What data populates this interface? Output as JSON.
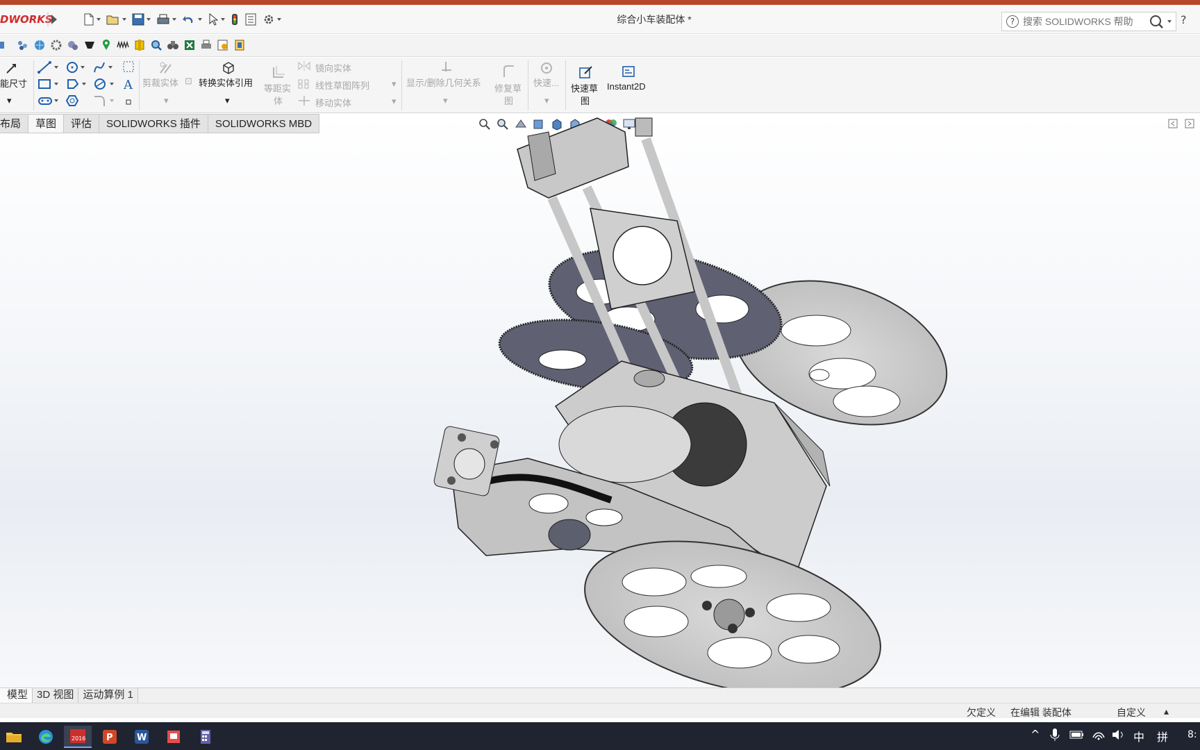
{
  "app": {
    "logo_text": "DWORKS",
    "document_title": "综合小车装配体 *"
  },
  "search": {
    "placeholder": "搜索 SOLIDWORKS 帮助",
    "help_symbol": "?"
  },
  "ribbon": {
    "smart_dimension": "能尺寸",
    "trim_entities": "剪裁实体",
    "convert_entities": "转换实体引用",
    "offset_entities_1": "等距实",
    "offset_entities_2": "体",
    "mirror_entities": "镜向实体",
    "linear_pattern": "线性草图阵列",
    "move_entities": "移动实体",
    "display_relations": "显示/删除几何关系",
    "repair_sketch_1": "修复草",
    "repair_sketch_2": "图",
    "quick_snaps": "快速...",
    "rapid_sketch_1": "快速草",
    "rapid_sketch_2": "图",
    "instant2d": "Instant2D"
  },
  "tabs": [
    {
      "label": "布局",
      "active": false
    },
    {
      "label": "草图",
      "active": true
    },
    {
      "label": "评估",
      "active": false
    },
    {
      "label": "SOLIDWORKS 插件",
      "active": false
    },
    {
      "label": "SOLIDWORKS MBD",
      "active": false
    }
  ],
  "bottom_tabs": [
    {
      "label": "模型",
      "active": true
    },
    {
      "label": "3D 视图",
      "active": false
    },
    {
      "label": "运动算例 1",
      "active": false
    }
  ],
  "status": {
    "underdefined": "欠定义",
    "editing": "在编辑 装配体",
    "custom": "自定义"
  },
  "taskbar": {
    "ime_lang": "中",
    "ime_mode": "拼",
    "clock": "8:"
  },
  "colors": {
    "accent_red": "#b7472a",
    "logo_red": "#d12c2c",
    "taskbar_bg": "#1f2430"
  }
}
